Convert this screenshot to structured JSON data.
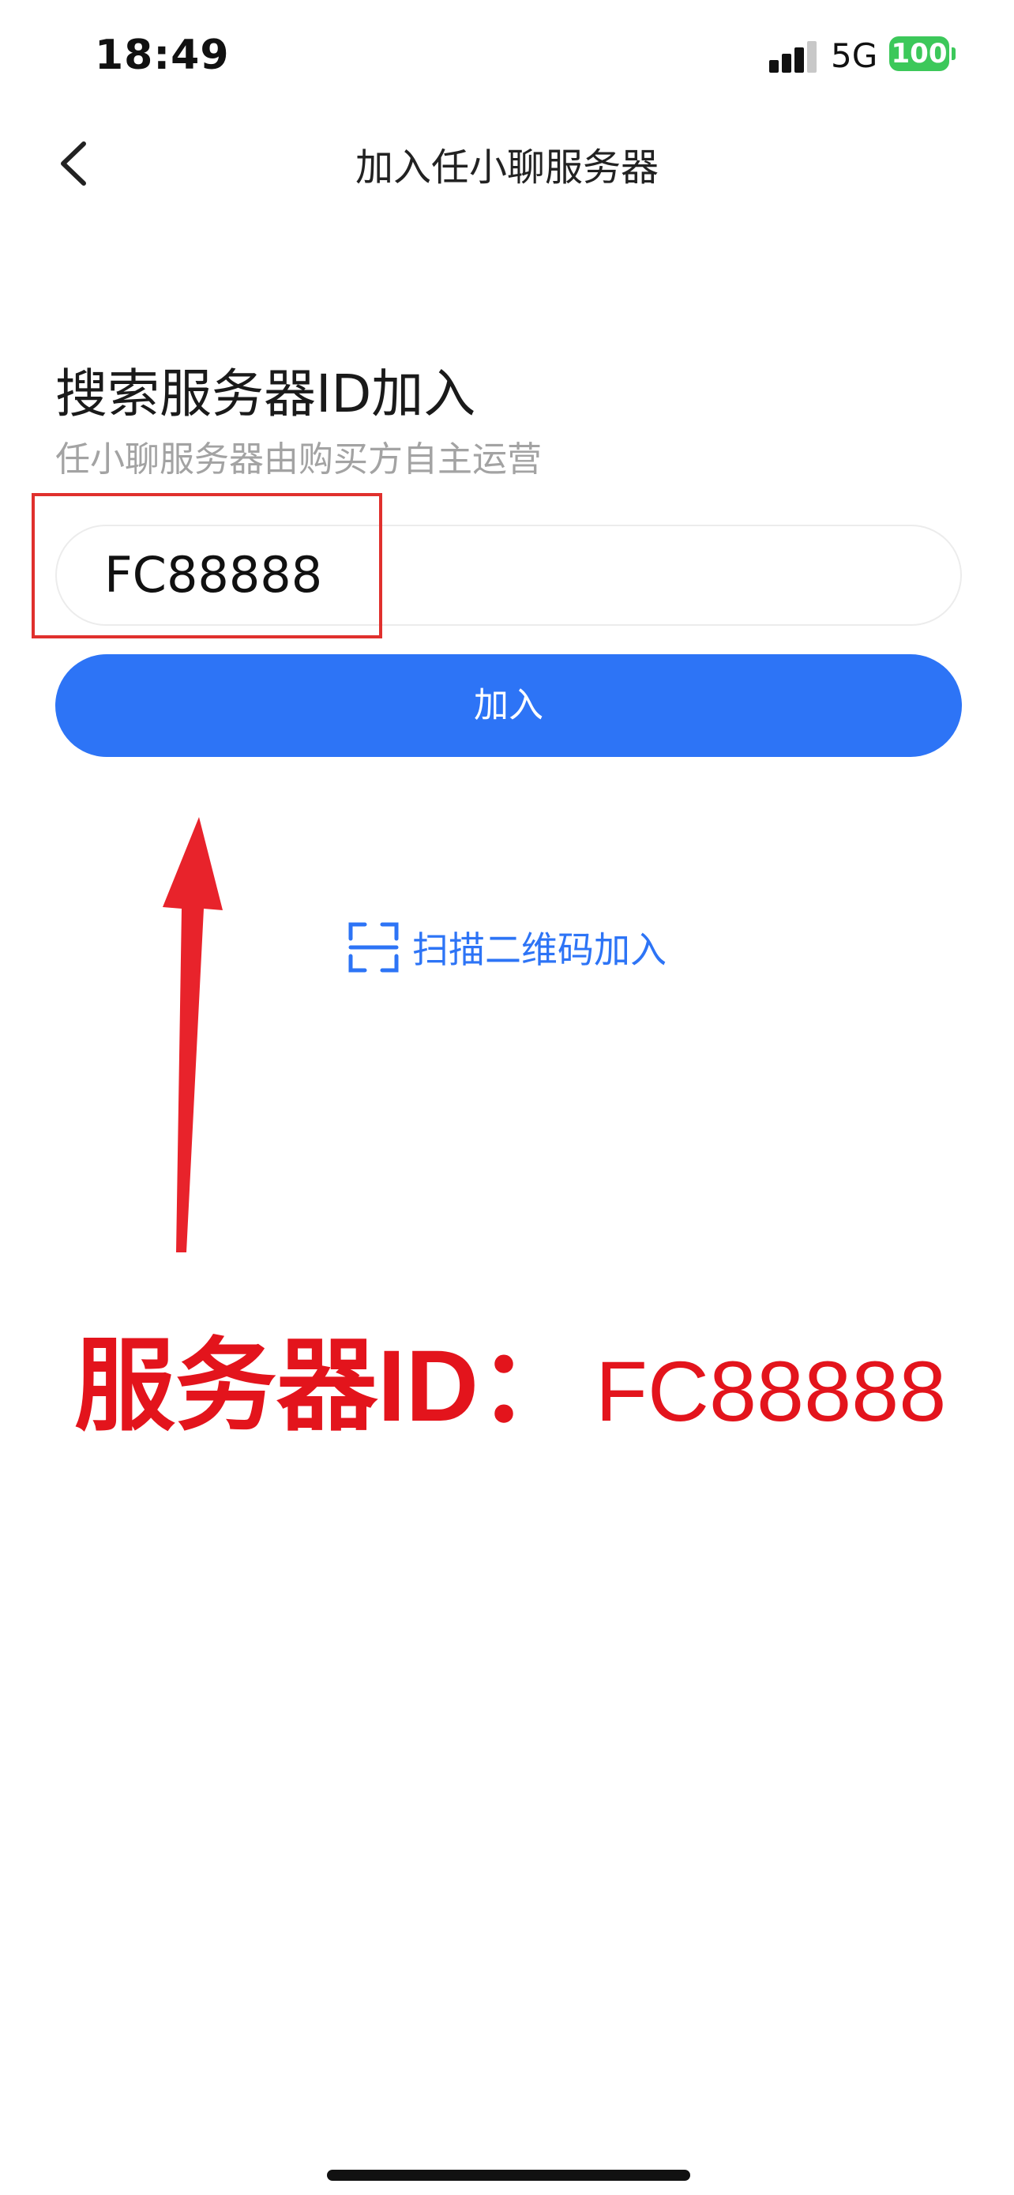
{
  "status_bar": {
    "time": "18:49",
    "network": "5G",
    "battery": "100",
    "battery_color": "#3cc85a"
  },
  "header": {
    "title": "加入任小聊服务器",
    "back_icon": "chevron-left-icon"
  },
  "search": {
    "title": "搜索服务器ID加入",
    "subtitle": "任小聊服务器由购买方自主运营",
    "input_value": "FC88888"
  },
  "join_button": {
    "label": "加入",
    "color": "#2d74f6"
  },
  "scan": {
    "label": "扫描二维码加入",
    "icon": "scan-qr-icon"
  },
  "annotation": {
    "label": "服务器ID：",
    "value": "FC88888",
    "color": "#e3141c"
  }
}
